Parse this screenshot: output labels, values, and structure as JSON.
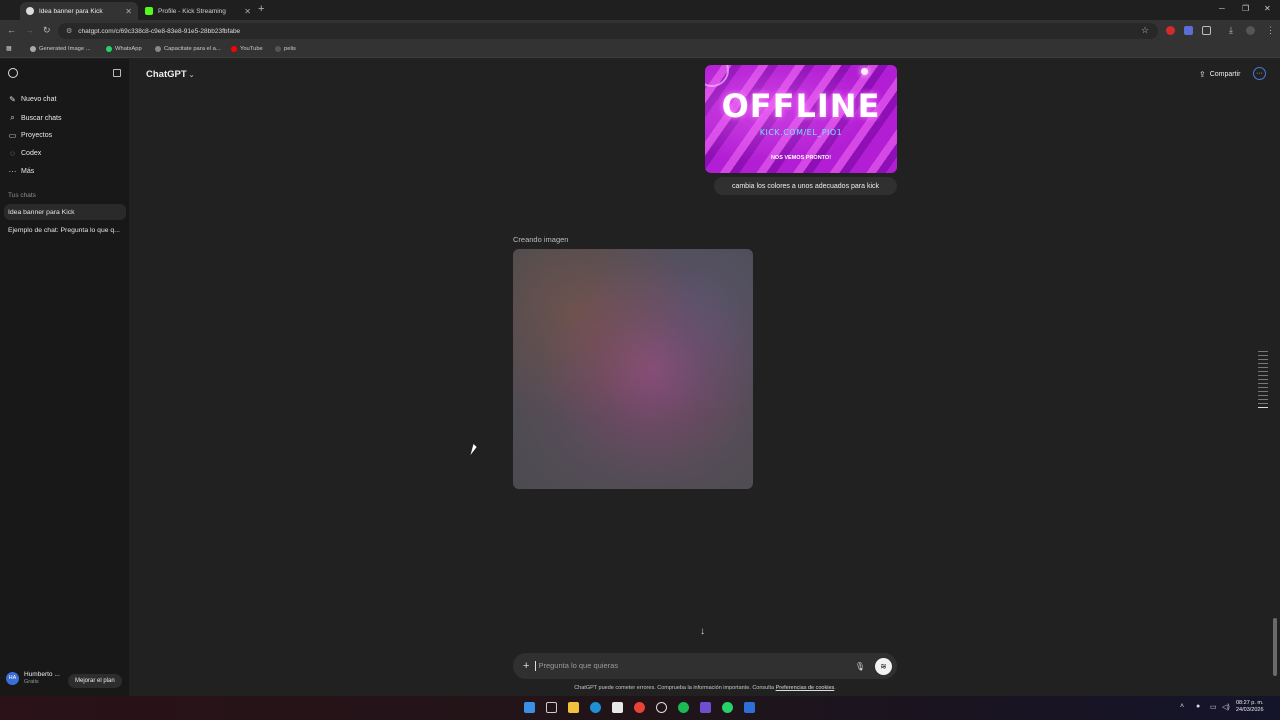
{
  "browser": {
    "tabs": [
      {
        "title": "Idea banner para Kick",
        "active": true
      },
      {
        "title": "Profile - Kick Streaming",
        "active": false
      }
    ],
    "url": "chatgpt.com/c/69c338c8-c9e8-83e8-91e5-28bb23fbfabe",
    "bookmarks": [
      "Generated Image ...",
      "WhatsApp",
      "Capacitate para el a...",
      "YouTube",
      "pelis"
    ]
  },
  "sidebar": {
    "nav": [
      {
        "label": "Nuevo chat",
        "icon": "edit-icon"
      },
      {
        "label": "Buscar chats",
        "icon": "search-icon"
      },
      {
        "label": "Proyectos",
        "icon": "folder-icon"
      },
      {
        "label": "Codex",
        "icon": "codex-icon"
      },
      {
        "label": "Más",
        "icon": "more-icon"
      }
    ],
    "section_label": "Tus chats",
    "chats": [
      {
        "title": "Idea banner para Kick",
        "active": true
      },
      {
        "title": "Ejemplo de chat: Pregunta lo que q...",
        "active": false
      }
    ],
    "user": {
      "initials": "HA",
      "name": "Humberto ...",
      "plan": "Gratis"
    },
    "upgrade_label": "Mejorar el plan"
  },
  "header": {
    "model": "ChatGPT",
    "share_label": "Compartir"
  },
  "conversation": {
    "banner": {
      "title": "OFFLINE",
      "url": "KICK.COM/EL_PIO1",
      "tagline": "NOS VEMOS PRONTO!"
    },
    "user_message": "cambia los colores a unos adecuados para kick",
    "status": "Creando imagen"
  },
  "composer": {
    "placeholder": "Pregunta lo que quieras",
    "disclaimer_prefix": "ChatGPT puede cometer errores. Comprueba la información importante. Consulta ",
    "disclaimer_link": "Preferencias de cookies",
    "disclaimer_suffix": "."
  },
  "taskbar": {
    "time": "08:27 p. m.",
    "date": "24/03/2026"
  },
  "colors": {
    "accent": "#53fc18",
    "banner_purple": "#b21ed3",
    "background": "#212121"
  }
}
